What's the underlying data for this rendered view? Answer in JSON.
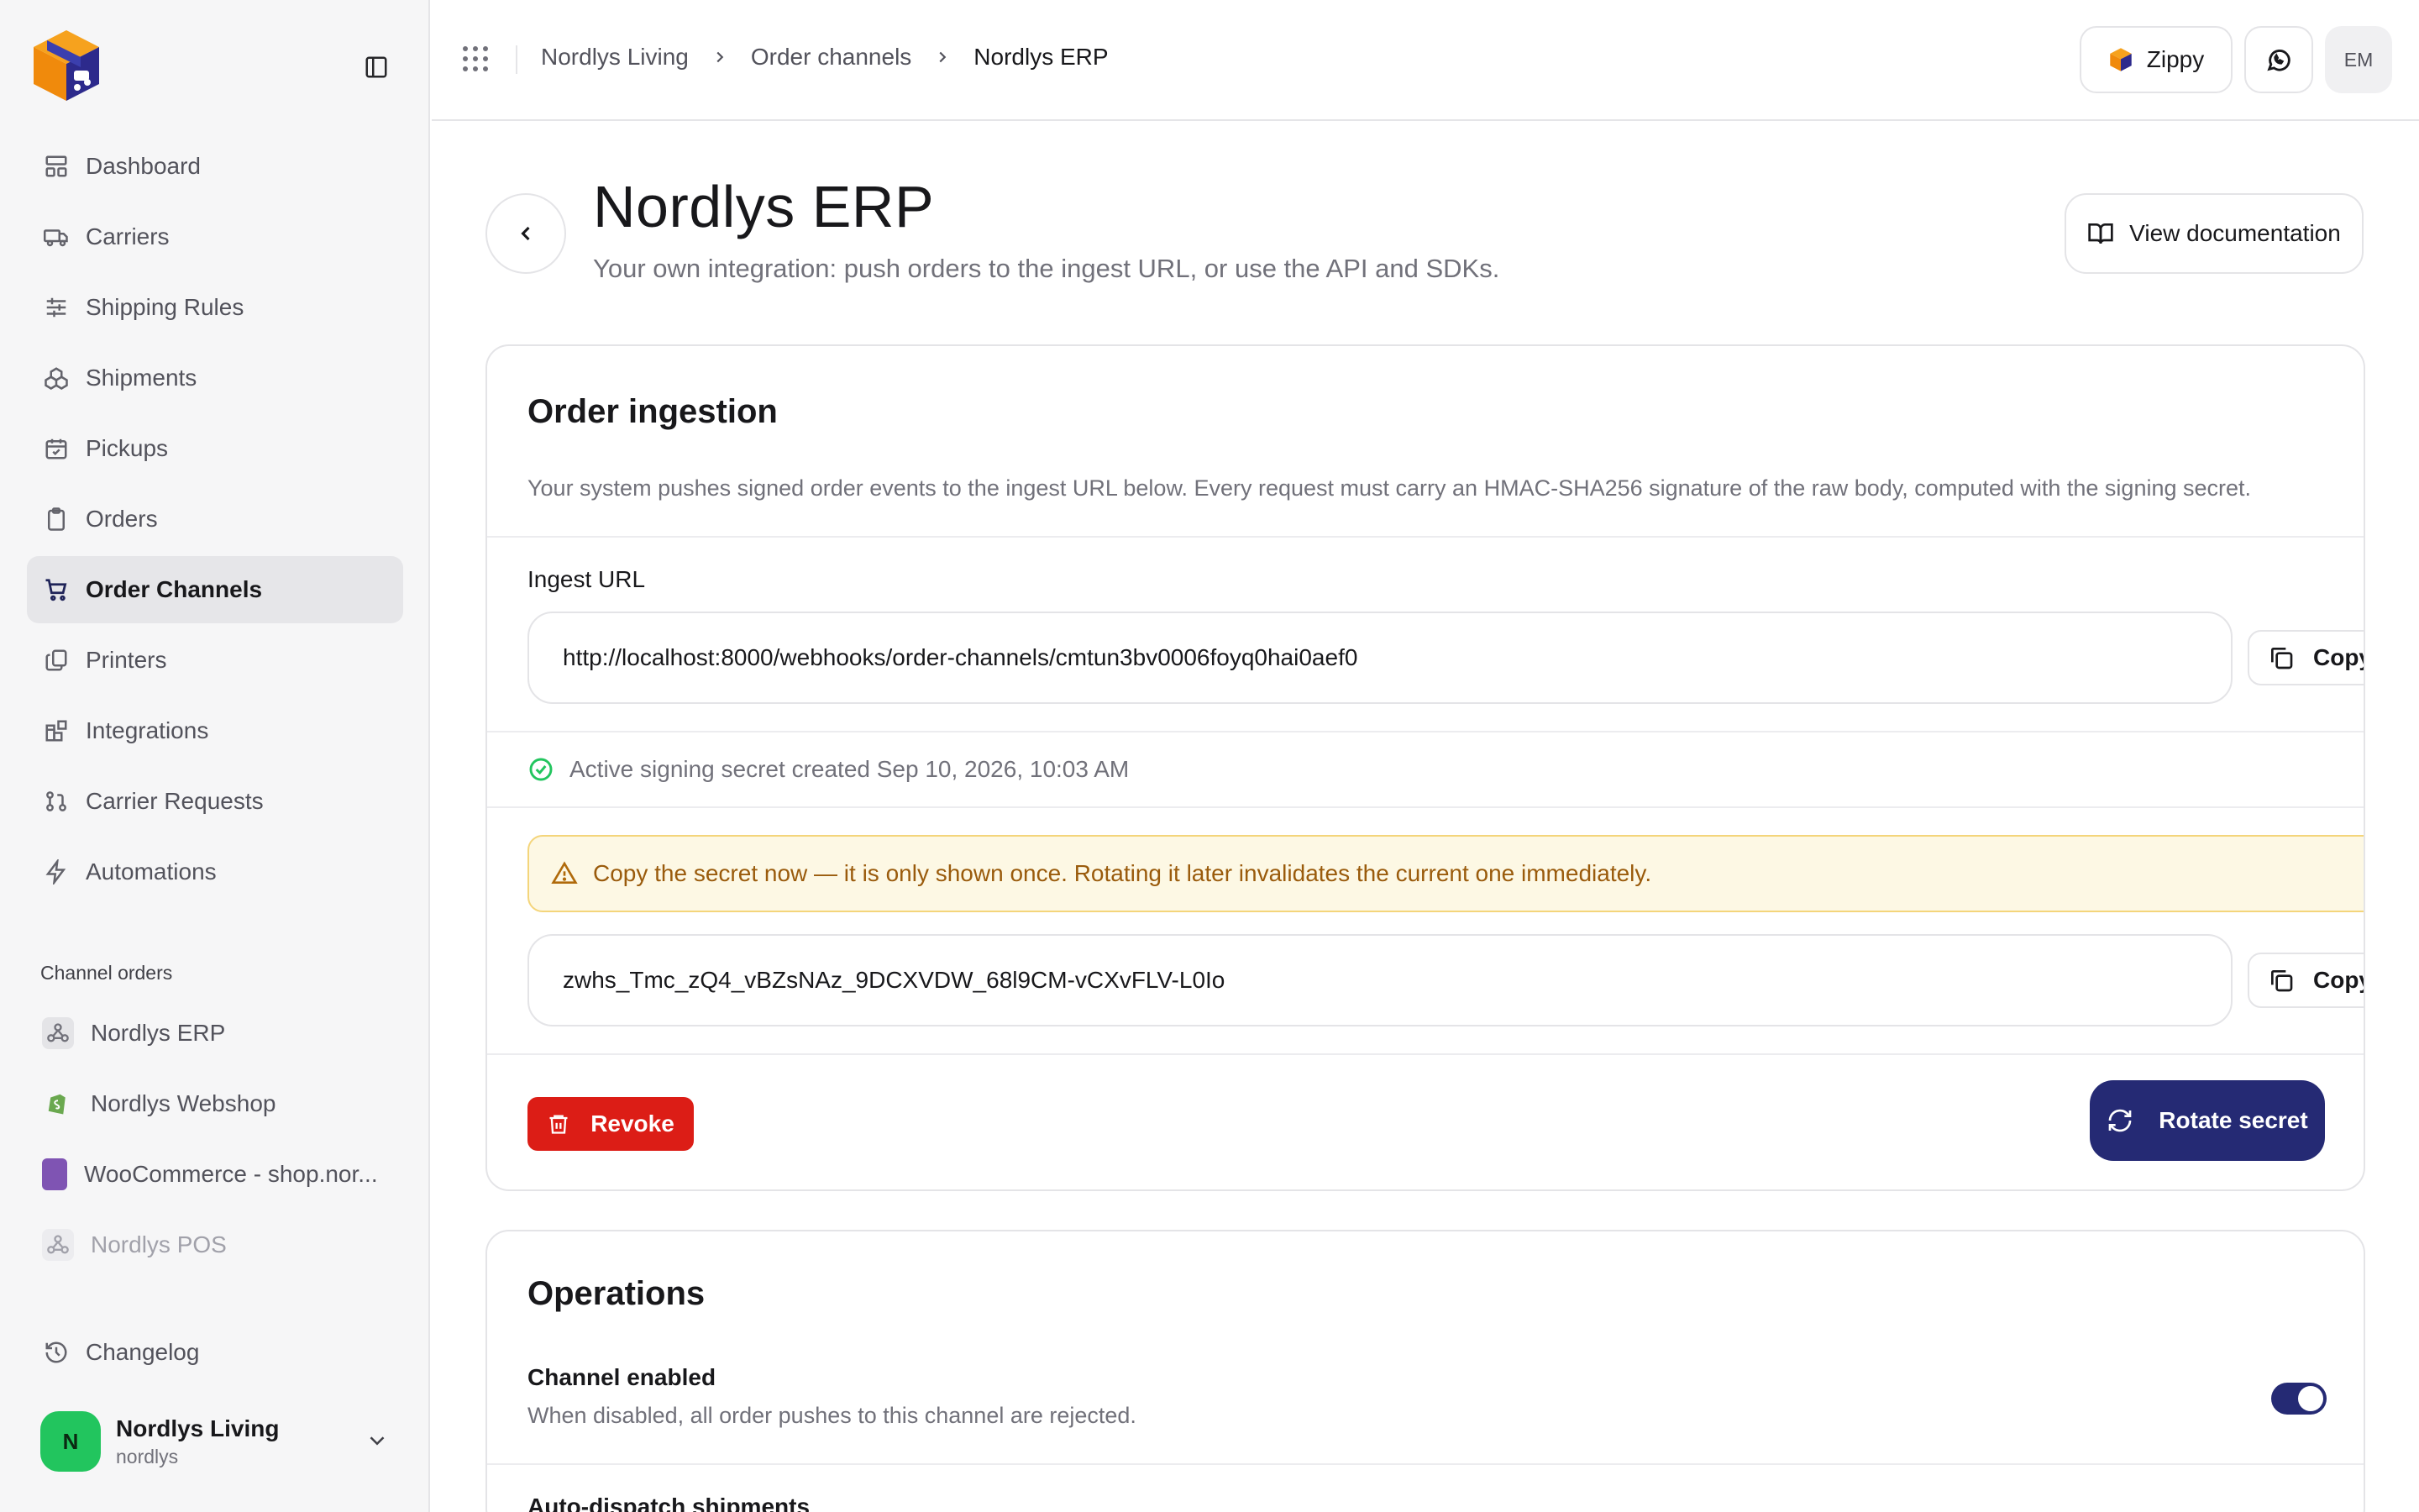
{
  "sidebar": {
    "nav": [
      {
        "label": "Dashboard",
        "icon": "dashboard-icon"
      },
      {
        "label": "Carriers",
        "icon": "truck-icon"
      },
      {
        "label": "Shipping Rules",
        "icon": "sliders-icon"
      },
      {
        "label": "Shipments",
        "icon": "boxes-icon"
      },
      {
        "label": "Pickups",
        "icon": "calendar-check-icon"
      },
      {
        "label": "Orders",
        "icon": "clipboard-icon"
      },
      {
        "label": "Order Channels",
        "icon": "cart-icon",
        "active": true
      },
      {
        "label": "Printers",
        "icon": "printer-icon"
      },
      {
        "label": "Integrations",
        "icon": "blocks-icon"
      },
      {
        "label": "Carrier Requests",
        "icon": "git-pull-request-icon"
      },
      {
        "label": "Automations",
        "icon": "zap-icon"
      }
    ],
    "channels_label": "Channel orders",
    "channels": [
      {
        "label": "Nordlys ERP",
        "icon": "webhook-icon"
      },
      {
        "label": "Nordlys Webshop",
        "icon": "shopify-icon"
      },
      {
        "label": "WooCommerce - shop.nor...",
        "icon": "woocommerce-icon"
      },
      {
        "label": "Nordlys POS",
        "icon": "webhook-icon"
      }
    ],
    "changelog": "Changelog",
    "org": {
      "initial": "N",
      "name": "Nordlys Living",
      "slug": "nordlys"
    }
  },
  "topbar": {
    "breadcrumb": [
      "Nordlys Living",
      "Order channels",
      "Nordlys ERP"
    ],
    "zippy_label": "Zippy",
    "user_initials": "EM"
  },
  "header": {
    "title": "Nordlys ERP",
    "subtitle": "Your own integration: push orders to the ingest URL, or use the API and SDKs.",
    "doc_button": "View documentation"
  },
  "ingestion": {
    "title": "Order ingestion",
    "description": "Your system pushes signed order events to the ingest URL below. Every request must carry an HMAC-SHA256 signature of the raw body, computed with the signing secret.",
    "url_label": "Ingest URL",
    "url_value": "http://localhost:8000/webhooks/order-channels/cmtun3bv0006foyq0hai0aef0",
    "copy_label": "Copy",
    "secret_status": "Active signing secret created Sep 10, 2026, 10:03 AM",
    "warning": "Copy the secret now — it is only shown once. Rotating it later invalidates the current one immediately.",
    "secret_value": "zwhs_Tmc_zQ4_vBZsNAz_9DCXVDW_68l9CM-vCXvFLV-L0Io",
    "revoke_label": "Revoke",
    "rotate_label": "Rotate secret"
  },
  "operations": {
    "title": "Operations",
    "channel_enabled_label": "Channel enabled",
    "channel_enabled_desc": "When disabled, all order pushes to this channel are rejected.",
    "channel_enabled": true,
    "auto_dispatch_label": "Auto-dispatch shipments"
  },
  "colors": {
    "brand": "#252a74",
    "danger": "#dc1d16",
    "success": "#22c55e",
    "warning_bg": "#fdf8e4",
    "warning_text": "#9a5b0c"
  }
}
